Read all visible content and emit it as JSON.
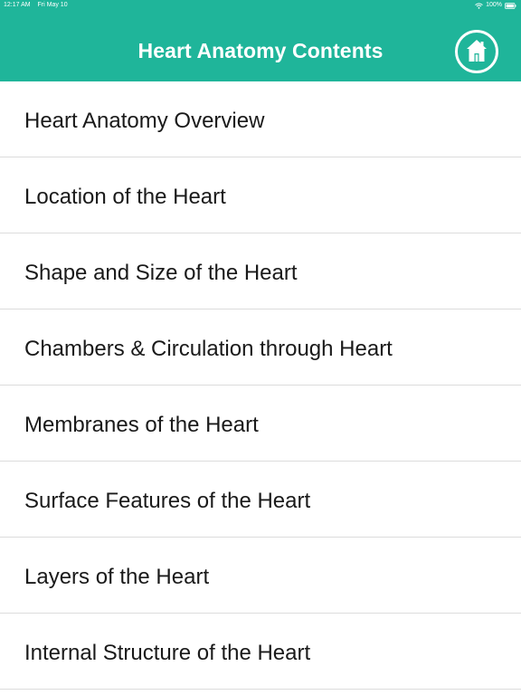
{
  "status_bar": {
    "time": "12:17 AM",
    "date": "Fri May 10",
    "battery": "100%",
    "wifi_icon": "wifi-icon",
    "battery_icon": "battery-icon"
  },
  "header": {
    "title": "Heart Anatomy Contents",
    "home_icon": "home-icon",
    "background": "#1fb59a"
  },
  "contents": [
    {
      "label": "Heart Anatomy Overview"
    },
    {
      "label": "Location of the Heart"
    },
    {
      "label": "Shape and Size of the Heart"
    },
    {
      "label": "Chambers & Circulation through Heart"
    },
    {
      "label": "Membranes of the Heart"
    },
    {
      "label": "Surface Features of the Heart"
    },
    {
      "label": "Layers of the Heart"
    },
    {
      "label": "Internal Structure of the Heart"
    }
  ]
}
